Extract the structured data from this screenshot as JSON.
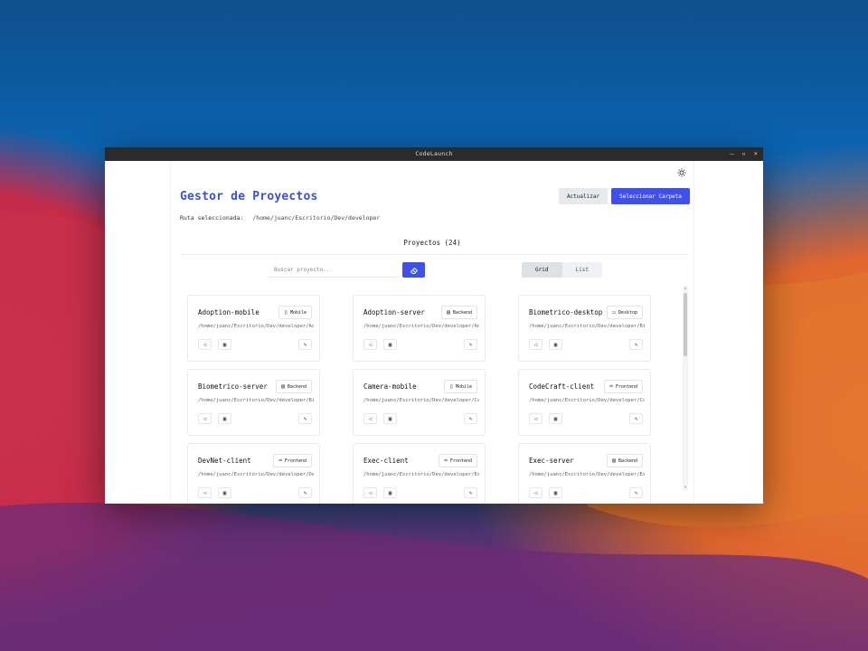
{
  "window": {
    "title": "CodeLaunch",
    "controls": [
      "–",
      "▫",
      "×"
    ]
  },
  "header": {
    "title": "Gestor de Proyectos",
    "refresh_label": "Actualizar",
    "select_folder_label": "Seleccionar Carpeta",
    "theme_icon": "sun-icon"
  },
  "route": {
    "label": "Ruta seleccionada:",
    "path": "/home/juanc/Escritorio/Dev/developer"
  },
  "projects": {
    "heading": "Proyectos (24)",
    "search_placeholder": "Buscar proyecto...",
    "view_options": [
      "Grid",
      "List"
    ],
    "active_view": "Grid"
  },
  "cards": [
    {
      "name": "Adoption-mobile",
      "type": "Mobile",
      "type_icon": "phone-icon",
      "path": "/home/juanc/Escritorio/Dev/developer/Ad..."
    },
    {
      "name": "Adoption-server",
      "type": "Backend",
      "type_icon": "server-icon",
      "path": "/home/juanc/Escritorio/Dev/developer/Ad..."
    },
    {
      "name": "Biometrico-desktop",
      "type": "Desktop",
      "type_icon": "monitor-icon",
      "path": "/home/juanc/Escritorio/Dev/developer/Bi..."
    },
    {
      "name": "Biometrico-server",
      "type": "Backend",
      "type_icon": "server-icon",
      "path": "/home/juanc/Escritorio/Dev/developer/Bi..."
    },
    {
      "name": "Camera-mobile",
      "type": "Mobile",
      "type_icon": "phone-icon",
      "path": "/home/juanc/Escritorio/Dev/developer/Ca..."
    },
    {
      "name": "CodeCraft-client",
      "type": "Frontend",
      "type_icon": "laptop-icon",
      "path": "/home/juanc/Escritorio/Dev/developer/Co..."
    },
    {
      "name": "DevNet-client",
      "type": "Frontend",
      "type_icon": "laptop-icon",
      "path": "/home/juanc/Escritorio/Dev/developer/De..."
    },
    {
      "name": "Exec-client",
      "type": "Frontend",
      "type_icon": "laptop-icon",
      "path": "/home/juanc/Escritorio/Dev/developer/Ex..."
    },
    {
      "name": "Exec-server",
      "type": "Backend",
      "type_icon": "server-icon",
      "path": "/home/juanc/Escritorio/Dev/developer/Ex..."
    }
  ],
  "colors": {
    "accent": "#3f51e8",
    "title": "#3b4fd8",
    "titlebar": "#2b2b2b"
  }
}
